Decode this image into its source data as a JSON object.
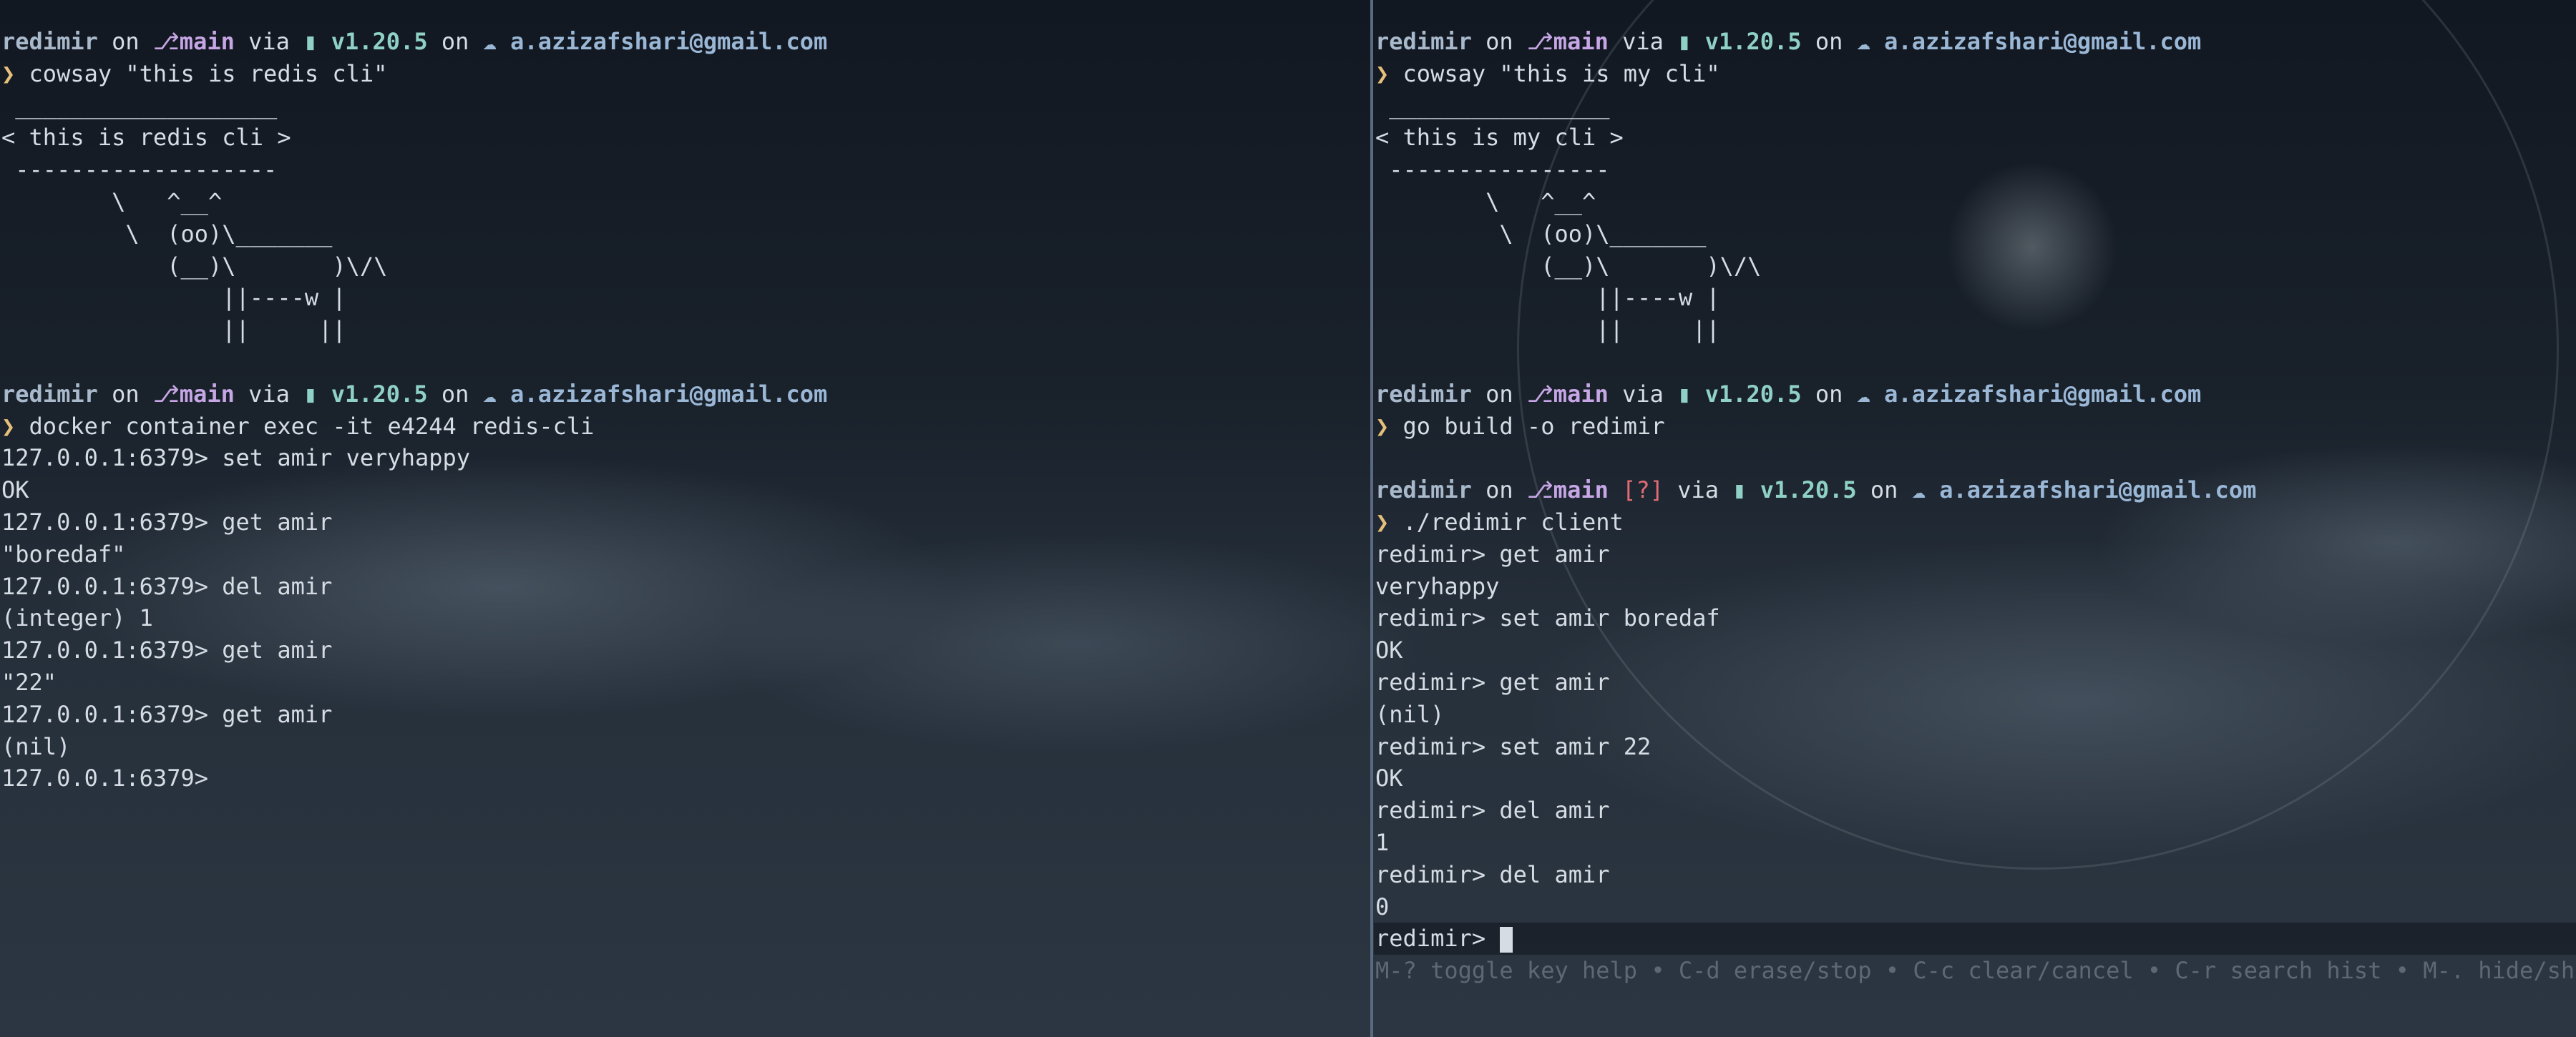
{
  "prompt_icons": {
    "branch": "git-branch-icon",
    "go": "go-gopher-icon",
    "cloud": "cloud-icon",
    "chevron": "chevron-right-icon"
  },
  "prompt": {
    "user": "redimir",
    "on": "on",
    "branch": "main",
    "via": "via",
    "go_version": "v1.20.5",
    "account": "a.azizafshari@gmail.com",
    "branch_glyph": "⎇",
    "go_glyph": "▮",
    "cloud_glyph": "☁",
    "chevron": "❯"
  },
  "left_pane": {
    "cmd1": "cowsay \"this is redis cli\"",
    "cow1": [
      " ___________________",
      "< this is redis cli >",
      " -------------------",
      "        \\   ^__^",
      "         \\  (oo)\\_______",
      "            (__)\\       )\\/\\",
      "                ||----w |",
      "                ||     ||"
    ],
    "cmd2": "docker container exec -it e4244 redis-cli",
    "session": [
      "127.0.0.1:6379> set amir veryhappy",
      "OK",
      "127.0.0.1:6379> get amir",
      "\"boredaf\"",
      "127.0.0.1:6379> del amir",
      "(integer) 1",
      "127.0.0.1:6379> get amir",
      "\"22\"",
      "127.0.0.1:6379> get amir",
      "(nil)",
      "127.0.0.1:6379>"
    ]
  },
  "right_pane": {
    "cmd1": "cowsay \"this is my cli\"",
    "cow1": [
      " ________________",
      "< this is my cli >",
      " ----------------",
      "        \\   ^__^",
      "         \\  (oo)\\_______",
      "            (__)\\       )\\/\\",
      "                ||----w |",
      "                ||     ||"
    ],
    "cmd2": "go build -o redimir",
    "git_status": "[?]",
    "cmd3": "./redimir client",
    "session": [
      "redimir> get amir",
      "veryhappy",
      "redimir> set amir boredaf",
      "OK",
      "redimir> get amir",
      "(nil)",
      "redimir> set amir 22",
      "OK",
      "redimir> del amir",
      "1",
      "redimir> del amir",
      "0"
    ],
    "input_prompt": "redimir>",
    "key_hints": "M-? toggle key help • C-d erase/stop • C-c clear/cancel • C-r search hist • M-. hide/show prompt"
  }
}
